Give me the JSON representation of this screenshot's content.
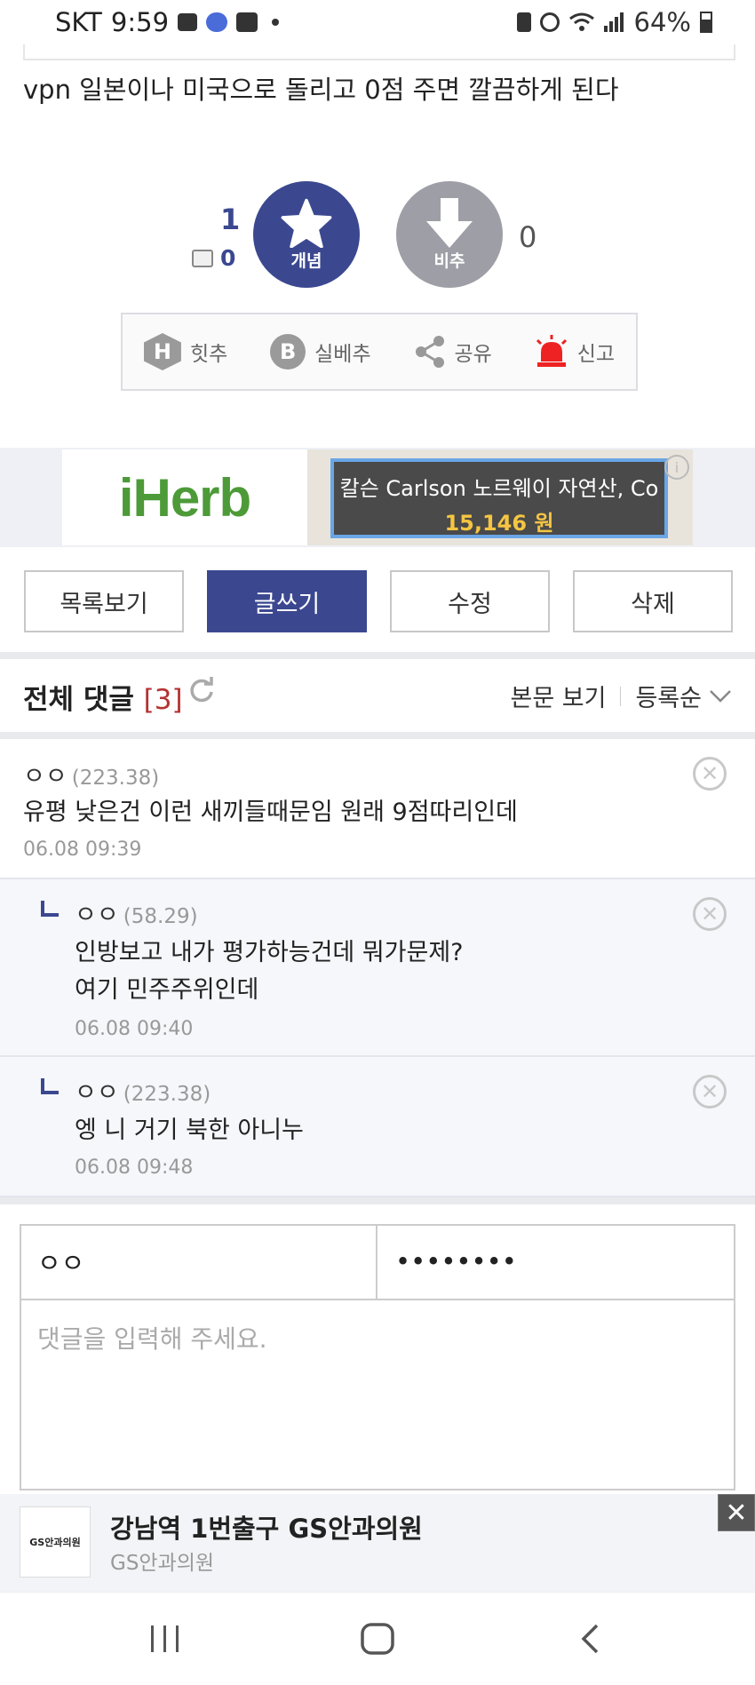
{
  "status_bar": {
    "carrier": "SKT",
    "time": "9:59",
    "battery": "64%"
  },
  "post": {
    "body": "vpn 일본이나 미국으로 돌리고 0점 주면 깔끔하게 된다"
  },
  "vote": {
    "up_count": "1",
    "up_fixed_count": "0",
    "up_label": "개념",
    "down_label": "비추",
    "down_count": "0"
  },
  "actions": [
    {
      "icon_text": "H",
      "label": "힛추"
    },
    {
      "icon_text": "B",
      "label": "실베추"
    },
    {
      "label": "공유"
    },
    {
      "label": "신고"
    }
  ],
  "ad": {
    "brand": "iHerb",
    "product": "칼슨 Carlson 노르웨이 자연산, Co",
    "price": "15,146 원",
    "info": "i"
  },
  "buttons": {
    "list": "목록보기",
    "write": "글쓰기",
    "edit": "수정",
    "delete": "삭제"
  },
  "comments_header": {
    "title": "전체 댓글",
    "count": "[3]",
    "view_post": "본문 보기",
    "sort": "등록순"
  },
  "comments": [
    {
      "author": "ㅇㅇ",
      "ip": "(223.38)",
      "lines": [
        "유평 낮은건 이런 새끼들때문임 원래 9점따리인데"
      ],
      "date": "06.08 09:39"
    },
    {
      "author": "ㅇㅇ",
      "ip": "(58.29)",
      "lines": [
        "인방보고 내가 평가하능건데 뭐가문제?",
        "여기 민주주위인데"
      ],
      "date": "06.08 09:40"
    },
    {
      "author": "ㅇㅇ",
      "ip": "(223.38)",
      "lines": [
        "엥 니 거기 북한 아니누"
      ],
      "date": "06.08 09:48"
    }
  ],
  "write_form": {
    "name": "ㅇㅇ",
    "password": "••••••••",
    "placeholder": "댓글을 입력해 주세요."
  },
  "bottom_ad": {
    "logo": "GS안과의원",
    "title": "강남역 1번출구 GS안과의원",
    "subtitle": "GS안과의원"
  }
}
